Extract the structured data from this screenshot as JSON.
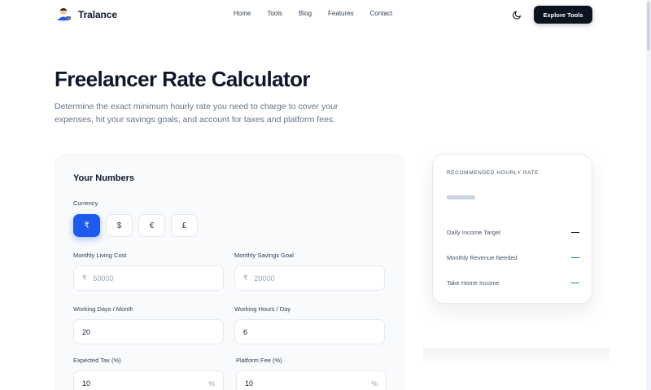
{
  "brand": {
    "name": "Tralance",
    "icon": "avatar-logo"
  },
  "nav": {
    "items": [
      "Home",
      "Tools",
      "Blog",
      "Features",
      "Contact"
    ]
  },
  "header": {
    "theme_icon": "moon-icon",
    "cta_label": "Explore Tools"
  },
  "hero": {
    "title": "Freelancer Rate Calculator",
    "subtitle": "Determine the exact minimum hourly rate you need to charge to cover your expenses, hit your savings goals, and account for taxes and platform fees."
  },
  "form": {
    "heading": "Your Numbers",
    "currency_label": "Currency",
    "currencies": [
      "₹",
      "$",
      "€",
      "£"
    ],
    "selected_currency": "₹",
    "living_cost": {
      "label": "Monthly Living Cost",
      "prefix": "₹",
      "placeholder": "50000"
    },
    "savings_goal": {
      "label": "Monthly Savings Goal",
      "prefix": "₹",
      "placeholder": "20000"
    },
    "working_days": {
      "label": "Working Days / Month",
      "value": "20"
    },
    "working_hours": {
      "label": "Working Hours / Day",
      "value": "6"
    },
    "tax": {
      "label": "Expected Tax (%)",
      "value": "10",
      "suffix": "%"
    },
    "platform_fee": {
      "label": "Platform Fee (%)",
      "value": "10",
      "suffix": "%"
    }
  },
  "result": {
    "label": "RECOMMENDED HOURLY RATE",
    "rows": [
      {
        "label": "Daily Income Target",
        "value": "—",
        "color": "#0f172a"
      },
      {
        "label": "Monthly Revenue Needed",
        "value": "—",
        "color": "#1d5bf0"
      },
      {
        "label": "Take Home Income",
        "value": "—",
        "color": "#0d9488"
      }
    ]
  },
  "colors": {
    "accent": "#1d5bf0",
    "dark": "#0b1220"
  }
}
